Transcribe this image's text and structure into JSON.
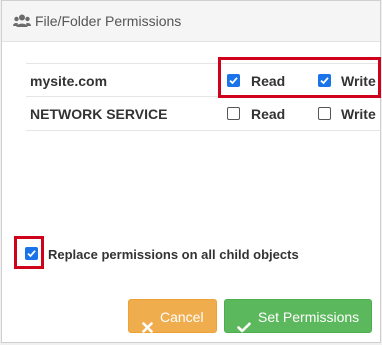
{
  "dialog": {
    "title": "File/Folder Permissions",
    "title_icon": "users-icon"
  },
  "permissions": [
    {
      "name": "mysite.com",
      "read_label": "Read",
      "write_label": "Write",
      "read": true,
      "write": true
    },
    {
      "name": "NETWORK SERVICE",
      "read_label": "Read",
      "write_label": "Write",
      "read": false,
      "write": false
    }
  ],
  "replace_option": {
    "label": "Replace permissions on all child objects",
    "checked": true
  },
  "buttons": {
    "cancel_label": "Cancel",
    "cancel_icon": "close-icon",
    "set_label": "Set Permissions",
    "set_icon": "checkmark-icon"
  },
  "colors": {
    "checkbox_checked": "#1a73e8",
    "highlight": "#d0021b",
    "cancel_bg": "#f0ad4e",
    "set_bg": "#5cb85c"
  }
}
